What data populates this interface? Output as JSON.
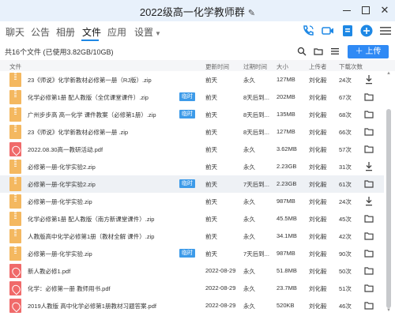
{
  "window": {
    "title": "2022级高一化学教师群"
  },
  "tabs": [
    {
      "label": "聊天"
    },
    {
      "label": "公告"
    },
    {
      "label": "相册"
    },
    {
      "label": "文件"
    },
    {
      "label": "应用"
    },
    {
      "label": "设置"
    }
  ],
  "toolbar": {
    "file_count": "共16个文件 (已使用3.82GB/10GB)",
    "upload_label": "上传"
  },
  "columns": {
    "name": "文件",
    "updated": "更新时间",
    "expiry": "过期时间",
    "size": "大小",
    "uploader": "上传者",
    "downloads": "下载次数"
  },
  "files": [
    {
      "type": "zip",
      "name": "23《师说》化学新教材必修第一册（RJ版）.zip",
      "tag": "",
      "updated": "前天",
      "expiry": "永久",
      "size": "127MB",
      "uploader": "刘化毅",
      "downloads": "24次",
      "action": "download"
    },
    {
      "type": "zip",
      "name": "化学必修第1册 配人教版（全优课堂课件）.zip",
      "tag": "临时",
      "updated": "前天",
      "expiry": "8天后到...",
      "size": "202MB",
      "uploader": "刘化毅",
      "downloads": "67次",
      "action": "folder"
    },
    {
      "type": "zip",
      "name": "广州步步高 高一化学 课件教案（必修第1册）.zip",
      "tag": "临时",
      "updated": "前天",
      "expiry": "8天后到...",
      "size": "135MB",
      "uploader": "刘化毅",
      "downloads": "68次",
      "action": "folder"
    },
    {
      "type": "zip",
      "name": "23《师说》化学新教材必修第一册 .zip",
      "tag": "",
      "updated": "前天",
      "expiry": "8天后到...",
      "size": "127MB",
      "uploader": "刘化毅",
      "downloads": "66次",
      "action": "folder"
    },
    {
      "type": "pdf",
      "name": "2022.08.30高一教研活动.pdf",
      "tag": "",
      "updated": "前天",
      "expiry": "永久",
      "size": "3.62MB",
      "uploader": "刘化毅",
      "downloads": "57次",
      "action": "folder"
    },
    {
      "type": "zip",
      "name": "必修第一册-化学实验2.zip",
      "tag": "",
      "updated": "前天",
      "expiry": "永久",
      "size": "2.23GB",
      "uploader": "刘化毅",
      "downloads": "31次",
      "action": "download"
    },
    {
      "type": "zip",
      "name": "必修第一册-化学实验2.zip",
      "tag": "临时",
      "updated": "前天",
      "expiry": "7天后到...",
      "size": "2.23GB",
      "uploader": "刘化毅",
      "downloads": "61次",
      "action": "folder",
      "selected": true
    },
    {
      "type": "zip",
      "name": "必修第一册-化学实验.zip",
      "tag": "",
      "updated": "前天",
      "expiry": "永久",
      "size": "987MB",
      "uploader": "刘化毅",
      "downloads": "24次",
      "action": "download"
    },
    {
      "type": "zip",
      "name": "化学必修第1册 配人教版（南方新课堂课件）.zip",
      "tag": "",
      "updated": "前天",
      "expiry": "永久",
      "size": "45.5MB",
      "uploader": "刘化毅",
      "downloads": "45次",
      "action": "folder"
    },
    {
      "type": "zip",
      "name": "人教版高中化学必修第1册（教材全解 课件）.zip",
      "tag": "",
      "updated": "前天",
      "expiry": "永久",
      "size": "34.1MB",
      "uploader": "刘化毅",
      "downloads": "42次",
      "action": "folder"
    },
    {
      "type": "zip",
      "name": "必修第一册-化学实验.zip",
      "tag": "临时",
      "updated": "前天",
      "expiry": "7天后到...",
      "size": "987MB",
      "uploader": "刘化毅",
      "downloads": "90次",
      "action": "folder"
    },
    {
      "type": "pdf",
      "name": "新人教必修1.pdf",
      "tag": "",
      "updated": "2022-08-29",
      "expiry": "永久",
      "size": "51.8MB",
      "uploader": "刘化毅",
      "downloads": "50次",
      "action": "folder"
    },
    {
      "type": "pdf",
      "name": "化学：必修第一册 教师用书.pdf",
      "tag": "",
      "updated": "2022-08-29",
      "expiry": "永久",
      "size": "23.7MB",
      "uploader": "刘化毅",
      "downloads": "51次",
      "action": "folder"
    },
    {
      "type": "pdf",
      "name": "2019人教版 高中化学必修第1册教材习题答案.pdf",
      "tag": "",
      "updated": "2022-08-29",
      "expiry": "永久",
      "size": "520KB",
      "uploader": "刘化毅",
      "downloads": "46次",
      "action": "folder"
    }
  ],
  "colors": {
    "accent": "#2f8af5",
    "tag": "#3d9be9",
    "zip_icon": "#f4b860",
    "pdf_icon": "#f06a6a",
    "titlebar": "#e8f1fb",
    "header_bg": "#f5f6f8",
    "selected_row": "#eef1f5"
  }
}
